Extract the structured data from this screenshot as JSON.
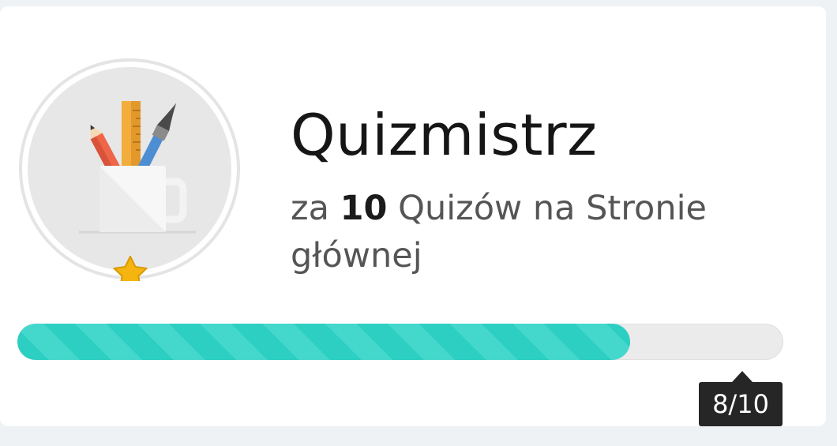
{
  "achievement": {
    "title": "Quizmistrz",
    "description_prefix": "za",
    "description_count": "10",
    "description_suffix": "Quizów na Stronie głównej",
    "icon": "pencil-cup-icon",
    "rank_icon": "star-icon"
  },
  "progress": {
    "label": "8/10",
    "current": 8,
    "total": 10,
    "fraction": 0.8,
    "color": "#2ccfc2",
    "track_color": "#ebebeb"
  },
  "colors": {
    "background": "#eef2f5",
    "card": "#ffffff",
    "tooltip": "#262626",
    "star": "#f5b40f"
  }
}
